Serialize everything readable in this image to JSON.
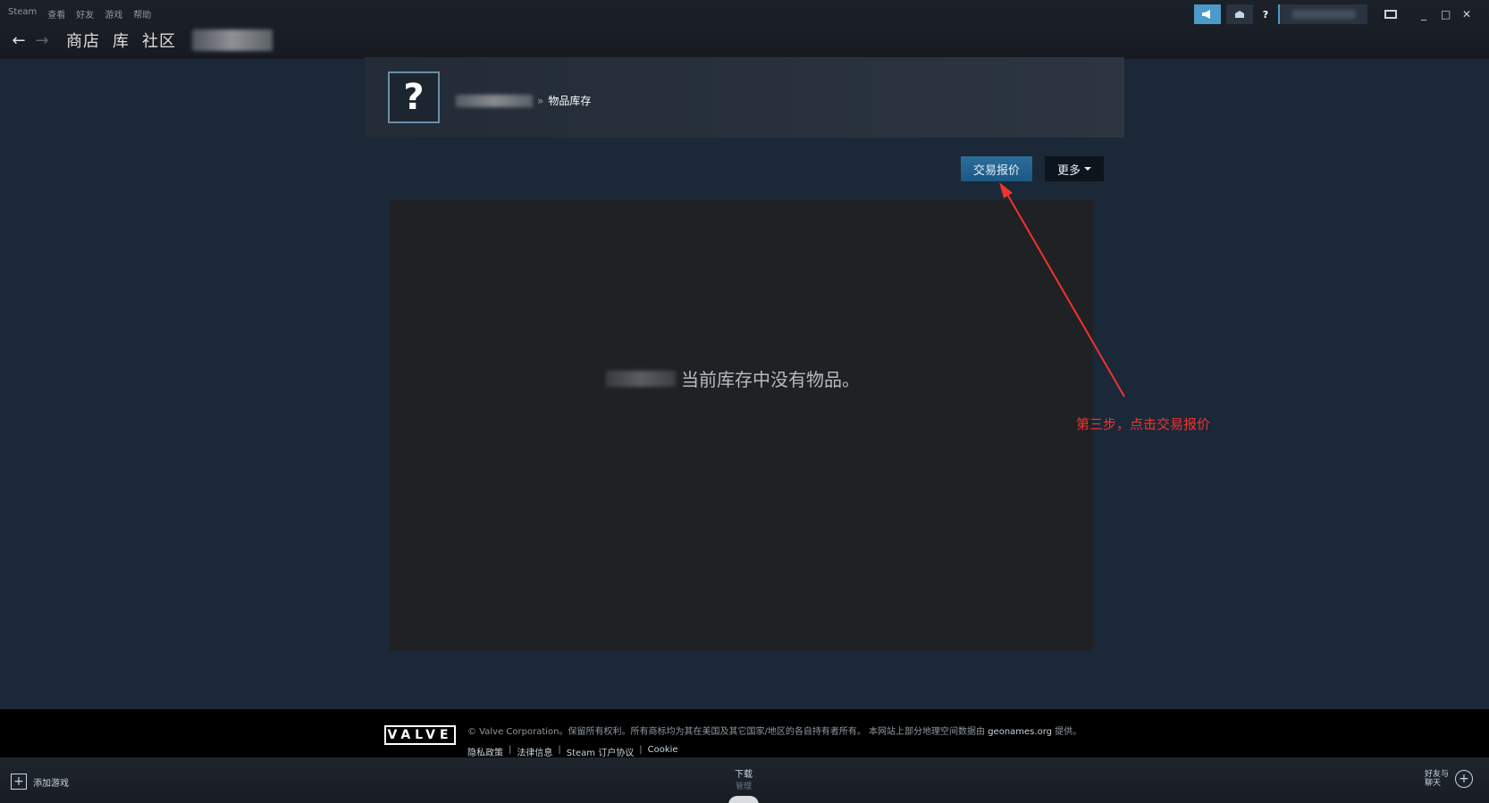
{
  "menu": {
    "steam": "Steam",
    "view": "查看",
    "friends": "好友",
    "games": "游戏",
    "help": "帮助"
  },
  "nav": {
    "back_icon": "←",
    "forward_icon": "→",
    "store": "商店",
    "library": "库",
    "community": "社区"
  },
  "titlebar": {
    "announce_icon": "megaphone-icon",
    "mail_icon": "envelope-icon",
    "help": "?",
    "minimize": "_",
    "maximize": "□",
    "close": "✕"
  },
  "profile": {
    "avatar_glyph": "?",
    "separator": "»",
    "page": "物品库存"
  },
  "actions": {
    "trade_offer": "交易报价",
    "more": "更多"
  },
  "inventory": {
    "empty_message": "当前库存中没有物品。"
  },
  "annotation": {
    "text": "第三步，点击交易报价",
    "color": "#f0332e"
  },
  "footer": {
    "logo": "VALVE",
    "copyright_a": "© Valve Corporation。保留所有权利。所有商标均为其在美国及其它国家/地区的各自持有者所有。 本网站上部分地理空间数据由 ",
    "copyright_link": "geonames.org",
    "copyright_b": " 提供。",
    "links": {
      "privacy": "隐私政策",
      "legal": "法律信息",
      "ssa": "Steam 订户协议",
      "cookie": "Cookie"
    },
    "sep": "|"
  },
  "bottombar": {
    "add_game": "添加游戏",
    "downloads": "下载",
    "manage": "管理",
    "friends_l1": "好友与",
    "friends_l2": "聊天"
  },
  "colors": {
    "background": "#1b2838",
    "accent": "#4b9ac7",
    "trade_button": "#2c6d99"
  }
}
